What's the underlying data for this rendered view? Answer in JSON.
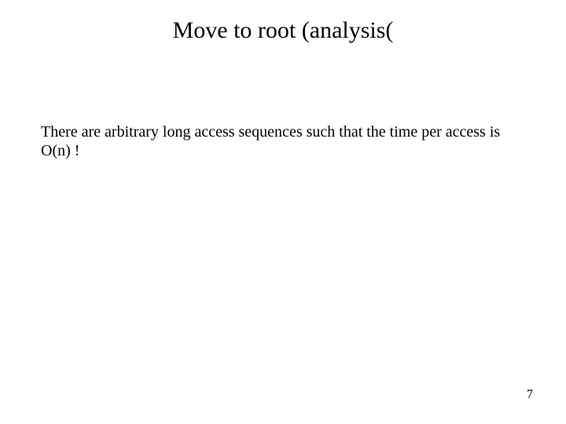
{
  "slide": {
    "title": "Move to root (analysis(",
    "body": "There are arbitrary long access sequences such that the time per access is O(n) !",
    "page_number": "7"
  }
}
